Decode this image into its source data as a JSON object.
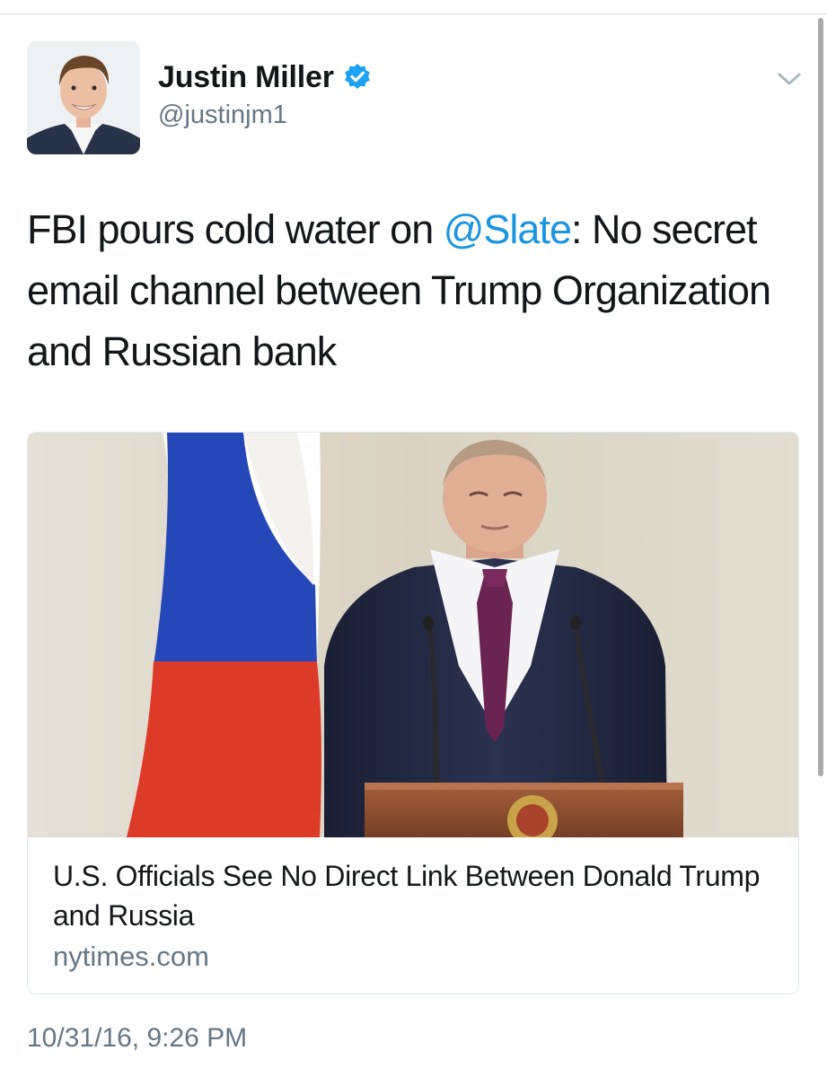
{
  "author": {
    "display_name": "Justin Miller",
    "handle": "@justinjm1",
    "verified": true
  },
  "tweet": {
    "text_before": "FBI pours cold water on ",
    "mention": "@Slate",
    "text_after": ": No secret email channel between Trump Organization and Russian bank"
  },
  "card": {
    "title": "U.S. Officials See No Direct Link Between Donald Trump and Russia",
    "domain": "nytimes.com"
  },
  "timestamp": "10/31/16, 9:26 PM",
  "icons": {
    "verified": "verified-badge-icon",
    "caret": "chevron-down-icon"
  },
  "colors": {
    "link_blue": "#1b95e0",
    "secondary_gray": "#657786",
    "text_dark": "#14171a"
  }
}
